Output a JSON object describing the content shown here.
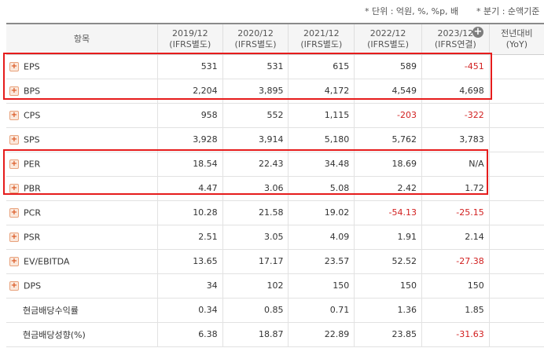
{
  "notes": {
    "unit": "* 단위 : 억원, %, %p, 배",
    "period": "* 분기 : 순액기준"
  },
  "columns": [
    {
      "line1": "항목",
      "line2": ""
    },
    {
      "line1": "2019/12",
      "line2": "(IFRS별도)"
    },
    {
      "line1": "2020/12",
      "line2": "(IFRS별도)"
    },
    {
      "line1": "2021/12",
      "line2": "(IFRS별도)"
    },
    {
      "line1": "2022/12",
      "line2": "(IFRS별도)"
    },
    {
      "line1": "2023/12",
      "line2": "(IFRS연결)"
    },
    {
      "line1": "전년대비",
      "line2": "(YoY)"
    }
  ],
  "expand_icon_glyph": "+",
  "add_column_icon_glyph": "+",
  "rows": [
    {
      "label": "EPS",
      "values": [
        "531",
        "531",
        "615",
        "589",
        "-451"
      ],
      "yoy": "",
      "expandable": true
    },
    {
      "label": "BPS",
      "values": [
        "2,204",
        "3,895",
        "4,172",
        "4,549",
        "4,698"
      ],
      "yoy": "",
      "expandable": true
    },
    {
      "label": "CPS",
      "values": [
        "958",
        "552",
        "1,115",
        "-203",
        "-322"
      ],
      "yoy": "",
      "expandable": true
    },
    {
      "label": "SPS",
      "values": [
        "3,928",
        "3,914",
        "5,180",
        "5,762",
        "3,783"
      ],
      "yoy": "",
      "expandable": true
    },
    {
      "label": "PER",
      "values": [
        "18.54",
        "22.43",
        "34.48",
        "18.69",
        "N/A"
      ],
      "yoy": "",
      "expandable": true
    },
    {
      "label": "PBR",
      "values": [
        "4.47",
        "3.06",
        "5.08",
        "2.42",
        "1.72"
      ],
      "yoy": "",
      "expandable": true
    },
    {
      "label": "PCR",
      "values": [
        "10.28",
        "21.58",
        "19.02",
        "-54.13",
        "-25.15"
      ],
      "yoy": "",
      "expandable": true
    },
    {
      "label": "PSR",
      "values": [
        "2.51",
        "3.05",
        "4.09",
        "1.91",
        "2.14"
      ],
      "yoy": "",
      "expandable": true
    },
    {
      "label": "EV/EBITDA",
      "values": [
        "13.65",
        "17.17",
        "23.57",
        "52.52",
        "-27.38"
      ],
      "yoy": "",
      "expandable": true
    },
    {
      "label": "DPS",
      "values": [
        "34",
        "102",
        "150",
        "150",
        "150"
      ],
      "yoy": "",
      "expandable": true
    },
    {
      "label": "현금배당수익률",
      "values": [
        "0.34",
        "0.85",
        "0.71",
        "1.36",
        "1.85"
      ],
      "yoy": "",
      "expandable": false
    },
    {
      "label": "현금배당성향(%)",
      "values": [
        "6.38",
        "18.87",
        "22.89",
        "23.85",
        "-31.63"
      ],
      "yoy": "",
      "expandable": false
    }
  ],
  "colors": {
    "highlight": "#e61c1c",
    "negative": "#d22020",
    "header_bg": "#f5f5f5"
  }
}
